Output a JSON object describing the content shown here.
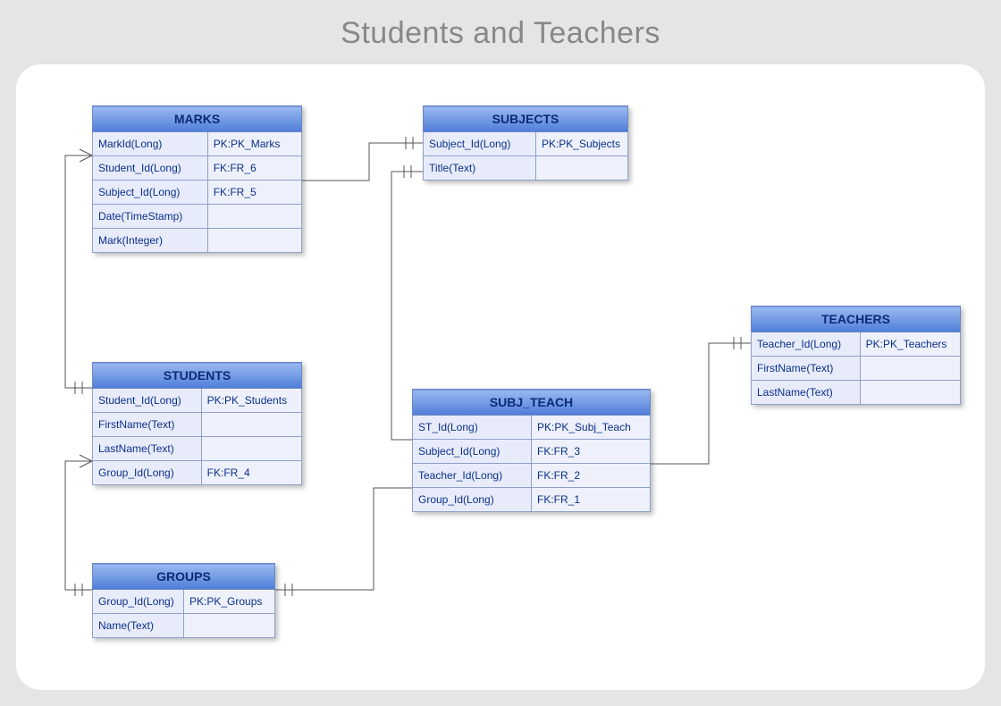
{
  "title": "Students and Teachers",
  "entities": {
    "marks": {
      "name": "MARKS",
      "rows": [
        {
          "field": "MarkId(Long)",
          "key": "PK:PK_Marks"
        },
        {
          "field": "Student_Id(Long)",
          "key": "FK:FR_6"
        },
        {
          "field": "Subject_Id(Long)",
          "key": "FK:FR_5"
        },
        {
          "field": "Date(TimeStamp)",
          "key": ""
        },
        {
          "field": "Mark(Integer)",
          "key": ""
        }
      ]
    },
    "subjects": {
      "name": "SUBJECTS",
      "rows": [
        {
          "field": "Subject_Id(Long)",
          "key": "PK:PK_Subjects"
        },
        {
          "field": "Title(Text)",
          "key": ""
        }
      ]
    },
    "students": {
      "name": "STUDENTS",
      "rows": [
        {
          "field": "Student_Id(Long)",
          "key": "PK:PK_Students"
        },
        {
          "field": "FirstName(Text)",
          "key": ""
        },
        {
          "field": "LastName(Text)",
          "key": ""
        },
        {
          "field": "Group_Id(Long)",
          "key": "FK:FR_4"
        }
      ]
    },
    "subj_teach": {
      "name": "SUBJ_TEACH",
      "rows": [
        {
          "field": "ST_Id(Long)",
          "key": "PK:PK_Subj_Teach"
        },
        {
          "field": "Subject_Id(Long)",
          "key": "FK:FR_3"
        },
        {
          "field": "Teacher_Id(Long)",
          "key": "FK:FR_2"
        },
        {
          "field": "Group_Id(Long)",
          "key": "FK:FR_1"
        }
      ]
    },
    "teachers": {
      "name": "TEACHERS",
      "rows": [
        {
          "field": "Teacher_Id(Long)",
          "key": "PK:PK_Teachers"
        },
        {
          "field": "FirstName(Text)",
          "key": ""
        },
        {
          "field": "LastName(Text)",
          "key": ""
        }
      ]
    },
    "groups": {
      "name": "GROUPS",
      "rows": [
        {
          "field": "Group_Id(Long)",
          "key": "PK:PK_Groups"
        },
        {
          "field": "Name(Text)",
          "key": ""
        }
      ]
    }
  }
}
